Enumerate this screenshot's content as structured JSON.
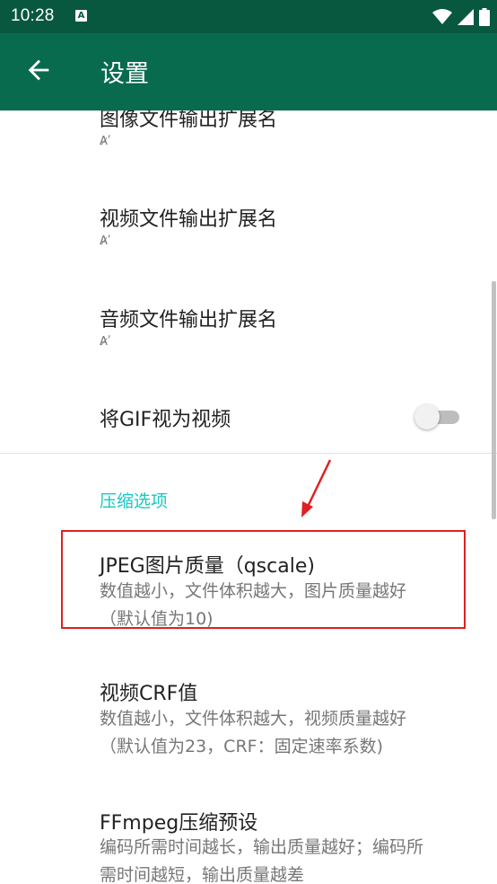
{
  "status_bar": {
    "time": "10:28",
    "notification_icon_letter": "A"
  },
  "app_bar": {
    "title": "设置"
  },
  "preferences": {
    "image_ext": {
      "title": "图像文件输出扩展名",
      "icon": "edit-text-icon"
    },
    "video_ext": {
      "title": "视频文件输出扩展名",
      "icon": "edit-text-icon"
    },
    "audio_ext": {
      "title": "音频文件输出扩展名",
      "icon": "edit-text-icon"
    },
    "gif_as_video": {
      "title": "将GIF视为视频",
      "toggle_on": false
    }
  },
  "compression": {
    "section_title": "压缩选项",
    "jpeg_quality": {
      "title": "JPEG图片质量（qscale)",
      "summary_line1": "数值越小，文件体积越大，图片质量越好",
      "summary_line2": "（默认值为10)"
    },
    "video_crf": {
      "title": "视频CRF值",
      "summary_line1": "数值越小，文件体积越大，视频质量越好",
      "summary_line2": "（默认值为23，CRF：固定速率系数)"
    },
    "ffmpeg_preset": {
      "title": "FFmpeg压缩预设",
      "summary_line1": "编码所需时间越长，输出质量越好；编码所",
      "summary_line2": "需时间越短，输出质量越差"
    }
  },
  "colors": {
    "status_bar": "#08573f",
    "app_bar": "#086b4e",
    "accent": "#19c7c1",
    "annotation": "#e02020"
  }
}
